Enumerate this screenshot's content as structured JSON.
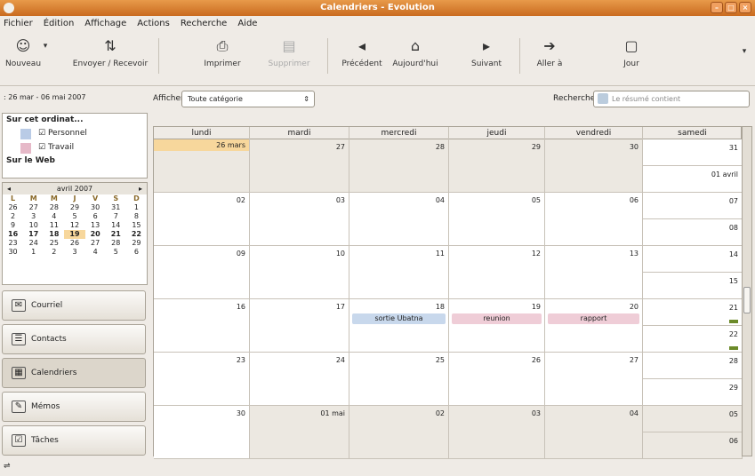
{
  "window": {
    "title": "Calendriers - Evolution"
  },
  "menu": [
    "Fichier",
    "Édition",
    "Affichage",
    "Actions",
    "Recherche",
    "Aide"
  ],
  "toolbar": {
    "new": "Nouveau",
    "send_receive": "Envoyer / Recevoir",
    "print": "Imprimer",
    "delete": "Supprimer",
    "previous": "Précédent",
    "today": "Aujourd'hui",
    "next": "Suivant",
    "goto": "Aller à",
    "day": "Jour"
  },
  "datebar": {
    "range": ": 26 mar - 06 mai 2007",
    "filter_label": "Afficher :",
    "filter_value": "Toute catégorie",
    "search_label": "Rechercher :",
    "search_placeholder": "Le résumé contient"
  },
  "sidebar": {
    "group_local": "Sur cet ordinat...",
    "calendars": [
      {
        "label": "Personnel",
        "color": "#b9cbe6"
      },
      {
        "label": "Travail",
        "color": "#e6b9c8"
      }
    ],
    "group_web": "Sur le Web",
    "minical": {
      "month": "avril 2007",
      "weekdays": [
        "L",
        "M",
        "M",
        "J",
        "V",
        "S",
        "D"
      ],
      "days": [
        "26",
        "27",
        "28",
        "29",
        "30",
        "31",
        "1",
        "2",
        "3",
        "4",
        "5",
        "6",
        "7",
        "8",
        "9",
        "10",
        "11",
        "12",
        "13",
        "14",
        "15",
        "16",
        "17",
        "18",
        "19",
        "20",
        "21",
        "22",
        "23",
        "24",
        "25",
        "26",
        "27",
        "28",
        "29",
        "30",
        "1",
        "2",
        "3",
        "4",
        "5",
        "6"
      ]
    },
    "nav": [
      {
        "label": "Courriel",
        "icon": "mail-icon"
      },
      {
        "label": "Contacts",
        "icon": "contacts-icon"
      },
      {
        "label": "Calendriers",
        "icon": "calendar-icon"
      },
      {
        "label": "Mémos",
        "icon": "memo-icon"
      },
      {
        "label": "Tâches",
        "icon": "tasks-icon"
      }
    ]
  },
  "calendar": {
    "weekdays": [
      "lundi",
      "mardi",
      "mercredi",
      "jeudi",
      "vendredi",
      "samedi"
    ],
    "weeks": [
      {
        "days": [
          "26 mars",
          "27",
          "28",
          "29",
          "30"
        ],
        "sat": "31",
        "sun": "01 avril"
      },
      {
        "days": [
          "02",
          "03",
          "04",
          "05",
          "06"
        ],
        "sat": "07",
        "sun": "08"
      },
      {
        "days": [
          "09",
          "10",
          "11",
          "12",
          "13"
        ],
        "sat": "14",
        "sun": "15"
      },
      {
        "days": [
          "16",
          "17",
          "18",
          "19",
          "20"
        ],
        "sat": "21",
        "sun": "22"
      },
      {
        "days": [
          "23",
          "24",
          "25",
          "26",
          "27"
        ],
        "sat": "28",
        "sun": "29"
      },
      {
        "days": [
          "30",
          "01 mai",
          "02",
          "03",
          "04"
        ],
        "sat": "05",
        "sun": "06"
      }
    ],
    "events": [
      {
        "label": "sortie Ubatna",
        "color": "#c8d8ec"
      },
      {
        "label": "reunion",
        "color": "#efcdd7"
      },
      {
        "label": "rapport",
        "color": "#efcdd7"
      }
    ]
  }
}
